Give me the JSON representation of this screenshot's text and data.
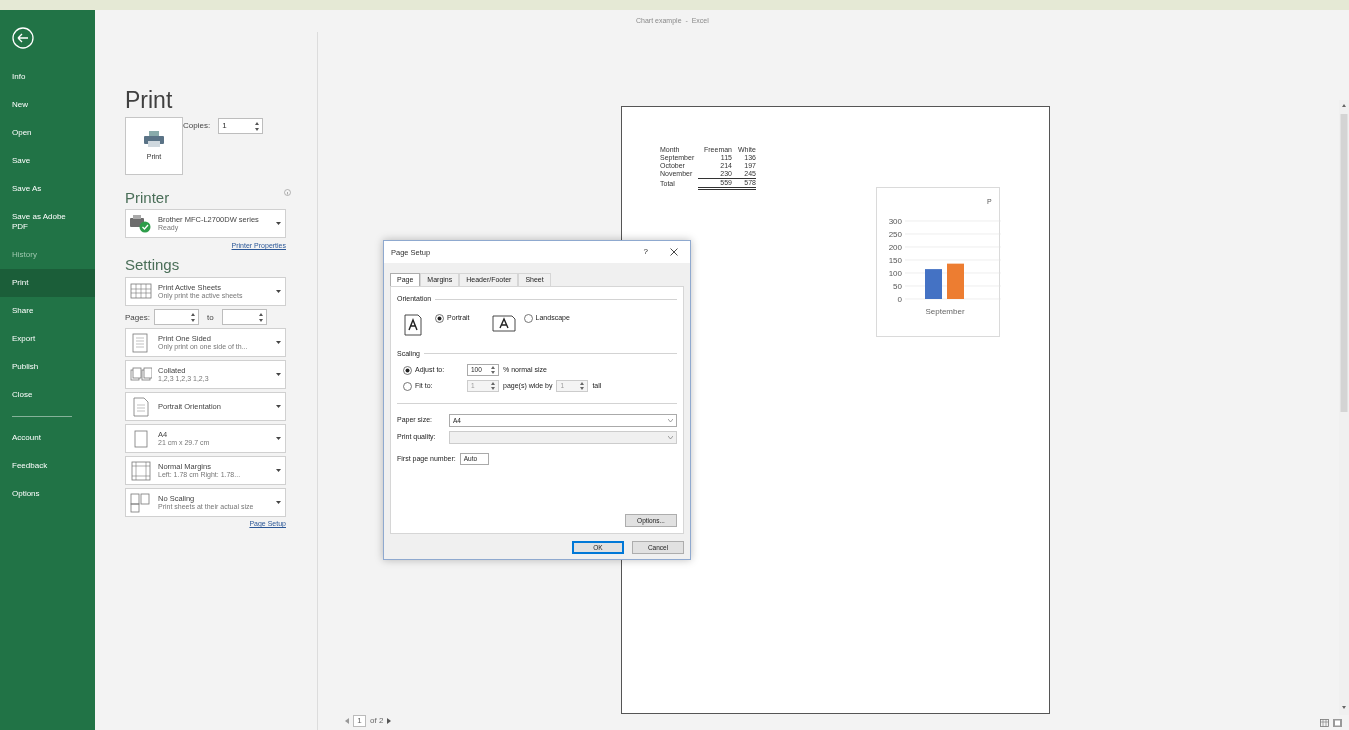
{
  "window": {
    "title": "Chart example  -  Excel"
  },
  "nav": {
    "items": [
      {
        "label": "Info",
        "selected": false,
        "disabled": false
      },
      {
        "label": "New",
        "selected": false,
        "disabled": false
      },
      {
        "label": "Open",
        "selected": false,
        "disabled": false
      },
      {
        "label": "Save",
        "selected": false,
        "disabled": false
      },
      {
        "label": "Save As",
        "selected": false,
        "disabled": false
      },
      {
        "label": "Save as Adobe PDF",
        "selected": false,
        "disabled": false
      },
      {
        "label": "History",
        "selected": false,
        "disabled": true
      },
      {
        "label": "Print",
        "selected": true,
        "disabled": false
      },
      {
        "label": "Share",
        "selected": false,
        "disabled": false
      },
      {
        "label": "Export",
        "selected": false,
        "disabled": false
      },
      {
        "label": "Publish",
        "selected": false,
        "disabled": false
      },
      {
        "label": "Close",
        "selected": false,
        "disabled": false
      }
    ],
    "footer_items": [
      {
        "label": "Account",
        "selected": false,
        "disabled": false
      },
      {
        "label": "Feedback",
        "selected": false,
        "disabled": false
      },
      {
        "label": "Options",
        "selected": false,
        "disabled": false
      }
    ]
  },
  "print_panel": {
    "heading": "Print",
    "print_button": "Print",
    "copies": {
      "label": "Copies:",
      "value": "1"
    },
    "printer": {
      "heading": "Printer",
      "name": "Brother MFC-L2700DW series",
      "status": "Ready",
      "link": "Printer Properties"
    },
    "settings": {
      "heading": "Settings",
      "items": [
        {
          "kind": "sheets",
          "title": "Print Active Sheets",
          "subtitle": "Only print the active sheets"
        },
        {
          "kind": "pages",
          "label": "Pages:",
          "separator": "to"
        },
        {
          "kind": "sided",
          "title": "Print One Sided",
          "subtitle": "Only print on one side of th..."
        },
        {
          "kind": "collated",
          "title": "Collated",
          "subtitle": "1,2,3   1,2,3   1,2,3"
        },
        {
          "kind": "orientation",
          "title": "Portrait Orientation"
        },
        {
          "kind": "paper",
          "title": "A4",
          "subtitle": "21 cm x 29.7 cm"
        },
        {
          "kind": "margins",
          "title": "Normal Margins",
          "subtitle": "Left:  1.78 cm    Right:  1.78..."
        },
        {
          "kind": "scaling",
          "title": "No Scaling",
          "subtitle": "Print sheets at their actual size"
        }
      ],
      "link": "Page Setup"
    }
  },
  "preview": {
    "table": {
      "columns": [
        "Month",
        "Freeman",
        "White"
      ],
      "rows": [
        [
          "September",
          "115",
          "136"
        ],
        [
          "October",
          "214",
          "197"
        ],
        [
          "November",
          "230",
          "245"
        ]
      ],
      "total": [
        "Total",
        "559",
        "578"
      ]
    },
    "chart": {
      "chart_data": {
        "type": "bar",
        "title": "P",
        "categories": [
          "September"
        ],
        "series": [
          {
            "color": "#4472c4",
            "values": [
              115
            ]
          },
          {
            "color": "#ed7d31",
            "values": [
              136
            ]
          }
        ],
        "grid": true,
        "ylim": [
          0,
          300
        ],
        "yticks": [
          0,
          50,
          100,
          150,
          200,
          250,
          300
        ]
      }
    },
    "pager": {
      "current": "1",
      "total": "of 2"
    }
  },
  "dialog": {
    "title": "Page Setup",
    "help": "?",
    "tabs": [
      {
        "label": "Page",
        "selected": true
      },
      {
        "label": "Margins",
        "selected": false
      },
      {
        "label": "Header/Footer",
        "selected": false
      },
      {
        "label": "Sheet",
        "selected": false
      }
    ],
    "orientation": {
      "heading": "Orientation",
      "options": [
        {
          "kind": "portrait",
          "label": "Portrait",
          "selected": true
        },
        {
          "kind": "landscape",
          "label": "Landscape",
          "selected": false
        }
      ]
    },
    "scaling": {
      "heading": "Scaling",
      "options": [
        {
          "kind": "adjust",
          "label": "Adjust to:",
          "selected": true,
          "value": "100",
          "suffix": "% normal size"
        },
        {
          "kind": "fit",
          "label": "Fit to:",
          "selected": false,
          "value": "1",
          "middle": "page(s) wide by",
          "value2": "1",
          "suffix": "tall"
        }
      ]
    },
    "fields": [
      {
        "kind": "select",
        "label": "Paper size:",
        "value": "A4",
        "disabled": false
      },
      {
        "kind": "select",
        "label": "Print quality:",
        "disabled": true
      },
      {
        "kind": "text",
        "label": "First page number:",
        "value": "Auto",
        "disabled": false
      }
    ],
    "buttons": [
      {
        "kind": "options",
        "label": "Options...",
        "default": false
      },
      {
        "kind": "footer",
        "label": "OK",
        "default": true
      },
      {
        "kind": "footer",
        "label": "Cancel",
        "default": false
      }
    ]
  }
}
